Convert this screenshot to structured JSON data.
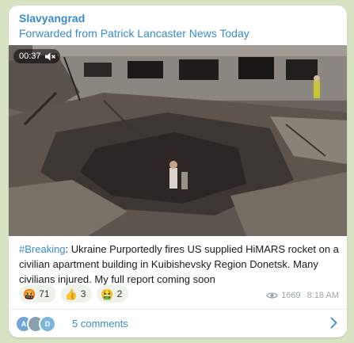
{
  "channel": {
    "name": "Slavyangrad",
    "forwarded_from": "Forwarded from Patrick Lancaster News Today"
  },
  "video": {
    "duration": "00:37",
    "muted_icon": "muted-speaker-icon"
  },
  "post": {
    "hashtag": "#Breaking",
    "text": ": Ukraine Purportedly fires US supplied HiMARS rocket on a civilian apartment building in Kuibishevsky Region Donetsk. Many civilians injured. My full report coming soon"
  },
  "reactions": [
    {
      "emoji": "🤬",
      "icon": "angry-face-icon",
      "count": "71"
    },
    {
      "emoji": "👍",
      "icon": "thumbs-up-icon",
      "count": "3"
    },
    {
      "emoji": "🤮",
      "icon": "vomiting-face-icon",
      "count": "2"
    }
  ],
  "meta": {
    "views": "1669",
    "time": "8:18 AM"
  },
  "comments": {
    "label": "5 comments",
    "avatars": [
      {
        "initials": "A",
        "color": "#6fa6d6"
      },
      {
        "initials": "",
        "color": "#8a9fb0"
      },
      {
        "initials": "D",
        "color": "#79b6dc"
      }
    ]
  },
  "colors": {
    "accent": "#3a8cc8",
    "background": "#d7e3c3"
  }
}
